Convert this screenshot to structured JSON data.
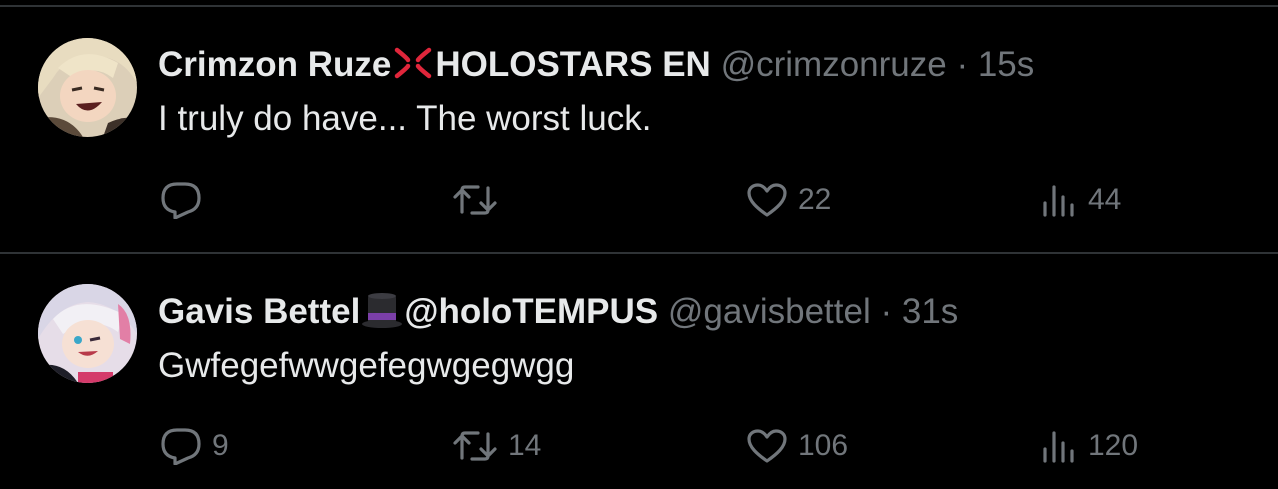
{
  "tweets": [
    {
      "display_name": "Crimzon Ruze",
      "emoji_icon": "anger-symbol-icon",
      "display_name_suffix": "HOLOSTARS EN",
      "handle": "@crimzonruze",
      "separator": "·",
      "time": "15s",
      "text": "I truly do have...  The worst luck.",
      "replies": "",
      "retweets": "",
      "likes": "22",
      "views": "44"
    },
    {
      "display_name": "Gavis Bettel",
      "emoji_icon": "top-hat-icon",
      "display_name_suffix": "@holoTEMPUS",
      "handle": "@gavisbettel",
      "separator": "·",
      "time": "31s",
      "text": "Gwfegefwwgefegwgegwgg",
      "replies": "9",
      "retweets": "14",
      "likes": "106",
      "views": "120"
    }
  ],
  "colors": {
    "background": "#000000",
    "divider": "#2f3336",
    "primary_text": "#e7e9ea",
    "secondary_text": "#71767b",
    "anger_symbol": "#e0263b",
    "top_hat": "#2b2b2f",
    "hat_band": "#7b3fa8"
  }
}
